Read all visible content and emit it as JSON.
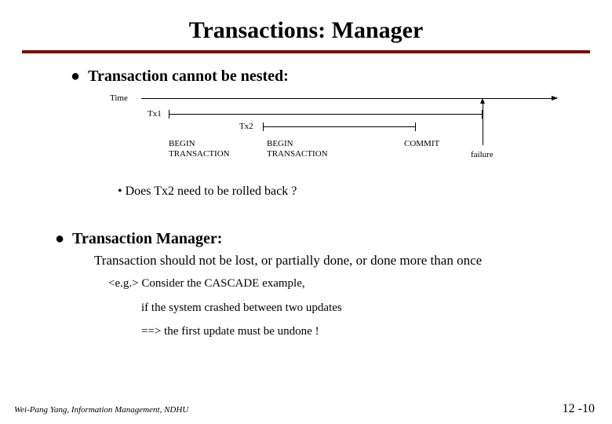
{
  "title": "Transactions: Manager",
  "bullet1": "Transaction cannot be nested:",
  "diagram": {
    "time": "Time",
    "tx1": "Tx1",
    "tx2": "Tx2",
    "begin": "BEGIN\nTRANSACTION",
    "commit": "COMMIT",
    "failure": "failure"
  },
  "question": "• Does Tx2 need to be rolled back ?",
  "bullet2": "Transaction Manager:",
  "subtext": "Transaction should not be lost, or partially done, or done more than once",
  "eg1": "<e.g.> Consider the  CASCADE  example,",
  "eg2": "if the system crashed between two updates",
  "eg3": "==> the first update must be undone !",
  "footer": "Wei-Pang Yang, Information Management, NDHU",
  "pagenum": "12 -10"
}
